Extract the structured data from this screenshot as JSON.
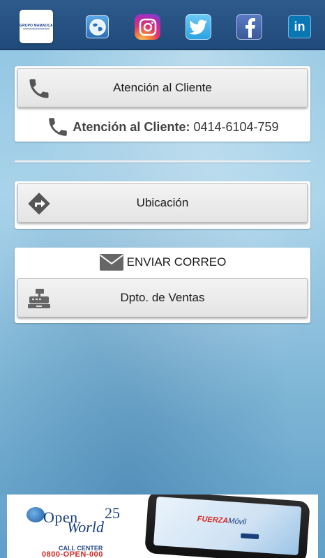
{
  "app": {
    "logo": {
      "brand_text": "GRUPO MAMAOCA"
    },
    "social": [
      {
        "name": "web",
        "icon": "globe-icon",
        "color": "#2a6fb8"
      },
      {
        "name": "instagram",
        "icon": "instagram-icon",
        "color": "#e0336f"
      },
      {
        "name": "twitter",
        "icon": "twitter-icon",
        "color": "#2aa3e4"
      },
      {
        "name": "facebook",
        "icon": "facebook-icon",
        "color": "#3b5998"
      },
      {
        "name": "linkedin",
        "icon": "linkedin-icon",
        "text": "in",
        "color": "#0a77b5"
      }
    ]
  },
  "customer_service": {
    "button_label": "Atención al Cliente",
    "info_label": "Atención al Cliente:",
    "info_phone": "0414-6104-759"
  },
  "location": {
    "button_label": "Ubicación"
  },
  "email": {
    "header_label": "ENVIAR CORREO",
    "sales_button_label": "Dpto. de Ventas"
  },
  "banner": {
    "brand": "Open",
    "anniversary": "25",
    "brand_world": "World",
    "call_center_label": "CALL CENTER",
    "call_center_phone": "0800-OPEN-000",
    "product_name_red": "FUERZA",
    "product_name_blue": "Móvil"
  }
}
